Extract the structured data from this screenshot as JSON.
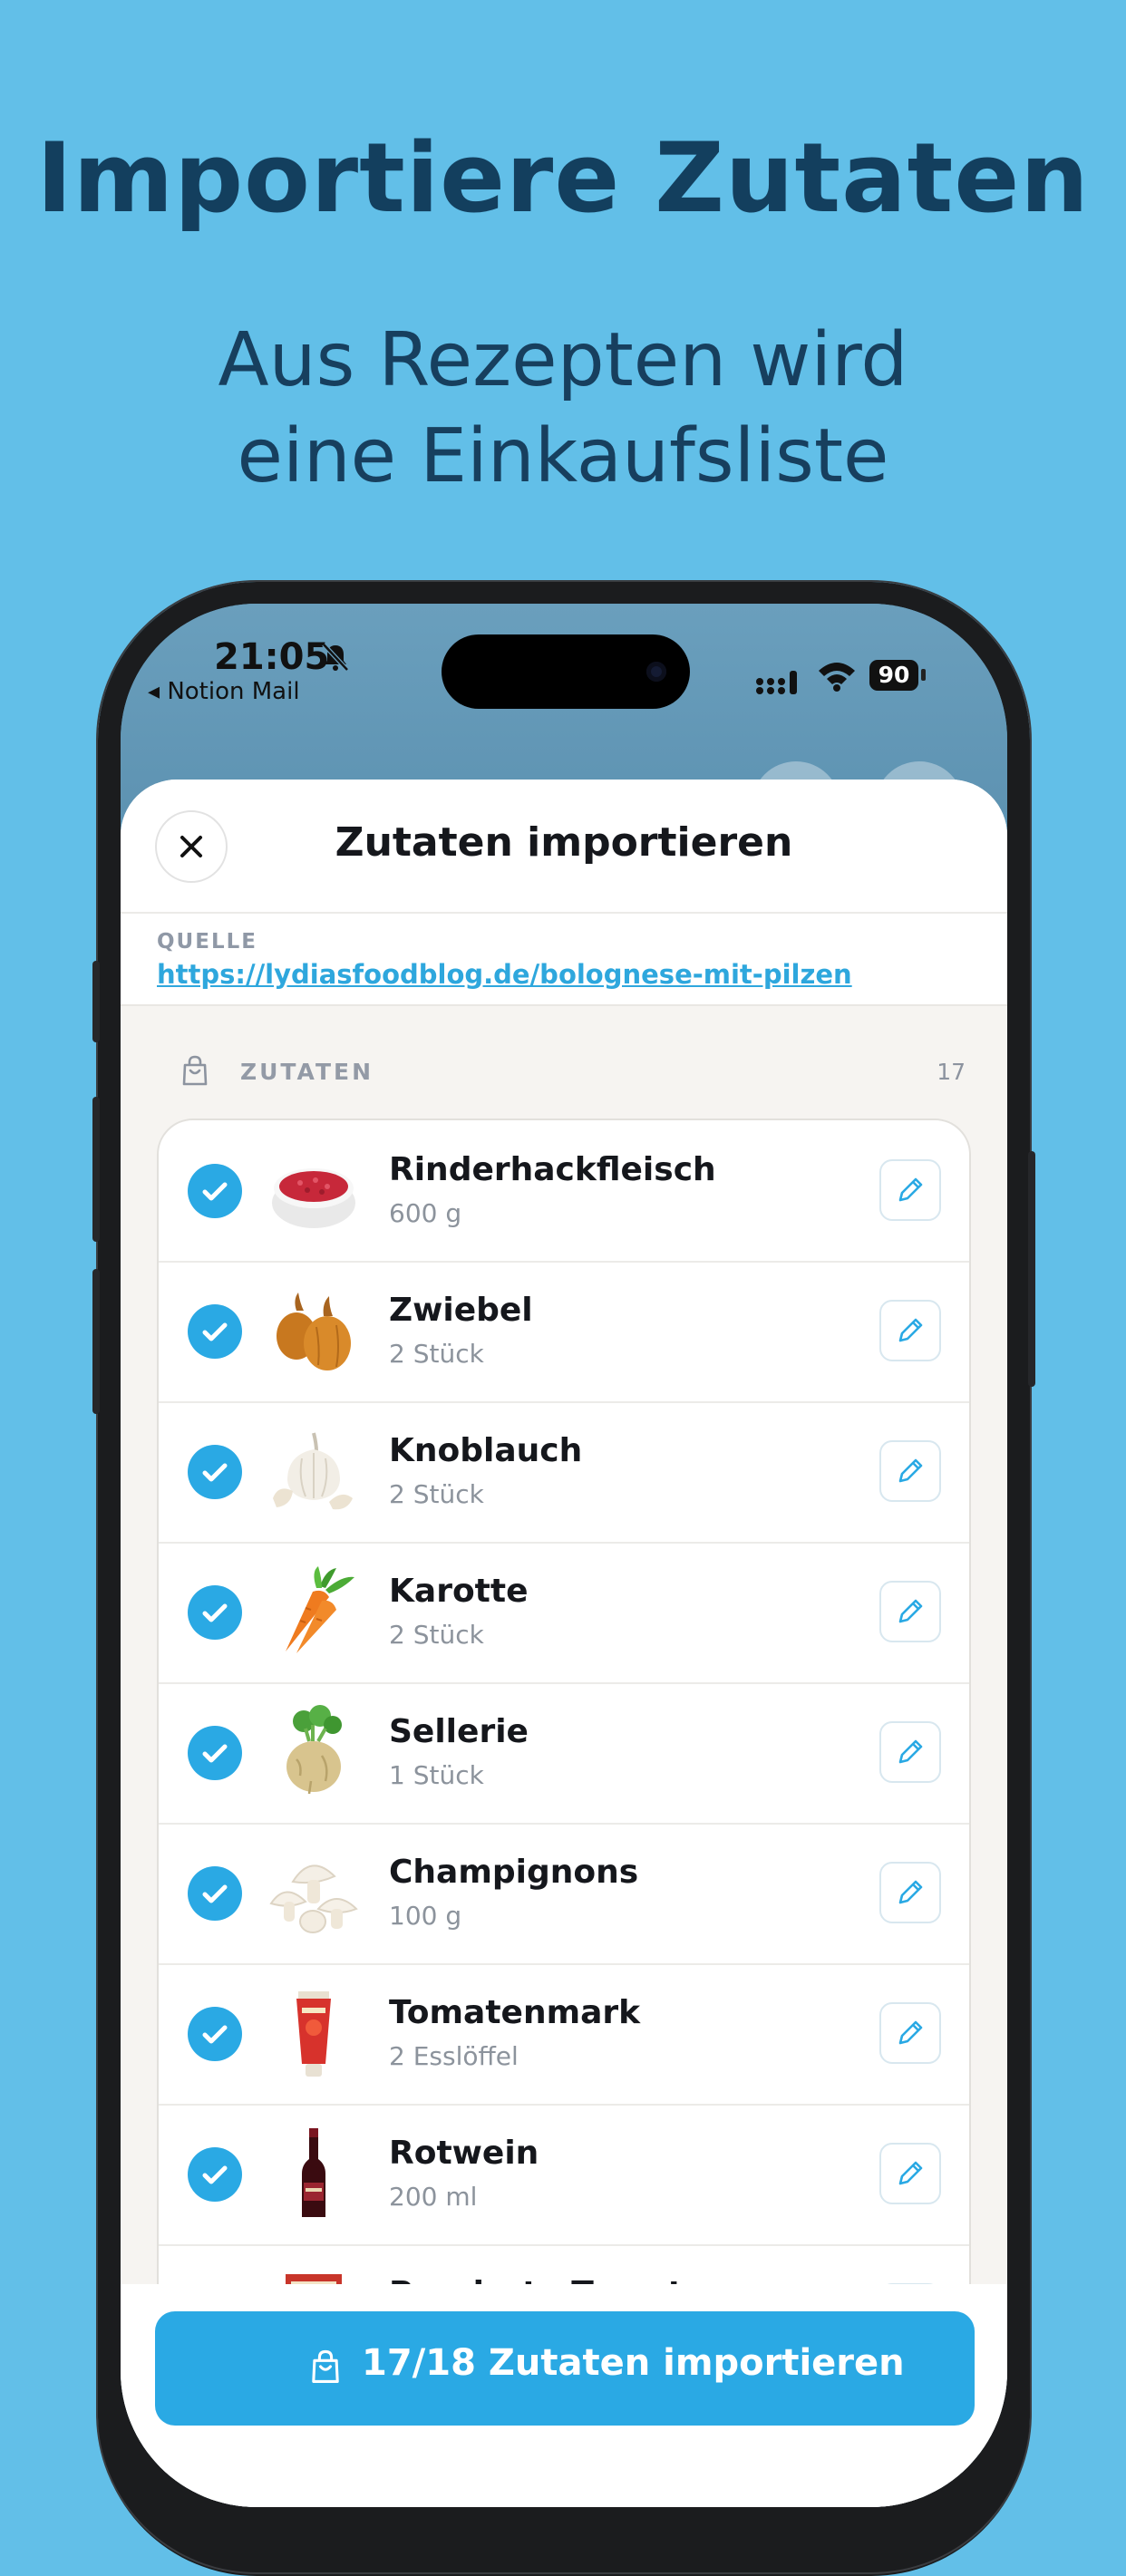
{
  "promo": {
    "headline": "Importiere Zutaten",
    "subline_1": "Aus Rezepten wird",
    "subline_2": "eine Einkaufsliste"
  },
  "status_bar": {
    "time": "21:05",
    "back_app": "◂ Notion Mail",
    "battery": "90"
  },
  "sheet": {
    "title": "Zutaten importieren",
    "source_label": "QUELLE",
    "source_url": "https://lydiasfoodblog.de/bolognese-mit-pilzen",
    "ingredients_label": "ZUTATEN",
    "ingredients_count": "17"
  },
  "items": [
    {
      "name": "Rinderhackfleisch",
      "qty": "600 g",
      "checked": true,
      "icon": "minced-meat"
    },
    {
      "name": "Zwiebel",
      "qty": "2 Stück",
      "checked": true,
      "icon": "onion"
    },
    {
      "name": "Knoblauch",
      "qty": "2 Stück",
      "checked": true,
      "icon": "garlic"
    },
    {
      "name": "Karotte",
      "qty": "2 Stück",
      "checked": true,
      "icon": "carrot"
    },
    {
      "name": "Sellerie",
      "qty": "1 Stück",
      "checked": true,
      "icon": "celery-root"
    },
    {
      "name": "Champignons",
      "qty": "100 g",
      "checked": true,
      "icon": "mushroom"
    },
    {
      "name": "Tomatenmark",
      "qty": "2 Esslöffel",
      "checked": true,
      "icon": "tomato-paste"
    },
    {
      "name": "Rotwein",
      "qty": "200 ml",
      "checked": true,
      "icon": "wine-bottle"
    },
    {
      "name": "Passierte Tomaten",
      "qty": "",
      "checked": true,
      "icon": "passata-box"
    }
  ],
  "import_button": {
    "label": "17/18 Zutaten importieren"
  },
  "colors": {
    "background": "#62bfe8",
    "accent": "#2aa9e4",
    "headline": "#133f5e"
  }
}
